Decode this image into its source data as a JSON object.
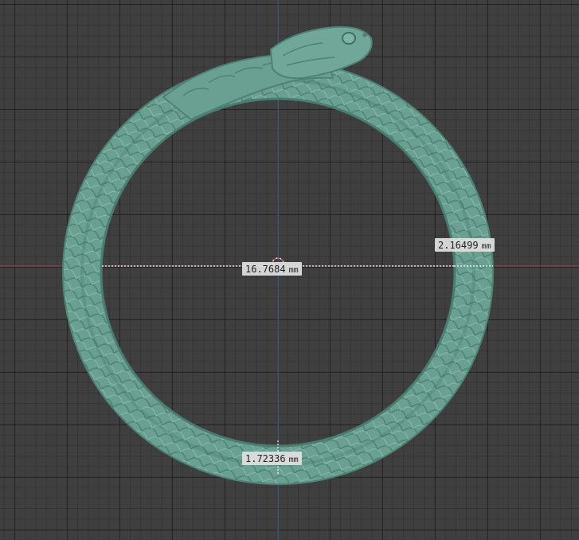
{
  "viewport": {
    "background": "#3f3f3f",
    "x_axis_color": "#9b4a4a",
    "y_axis_color": "#4a6a9b",
    "model_color": "#6fa597"
  },
  "measurements": [
    {
      "value": "16.7684",
      "unit": "mm"
    },
    {
      "value": "2.16499",
      "unit": "mm"
    },
    {
      "value": "1.72336",
      "unit": "mm"
    }
  ]
}
